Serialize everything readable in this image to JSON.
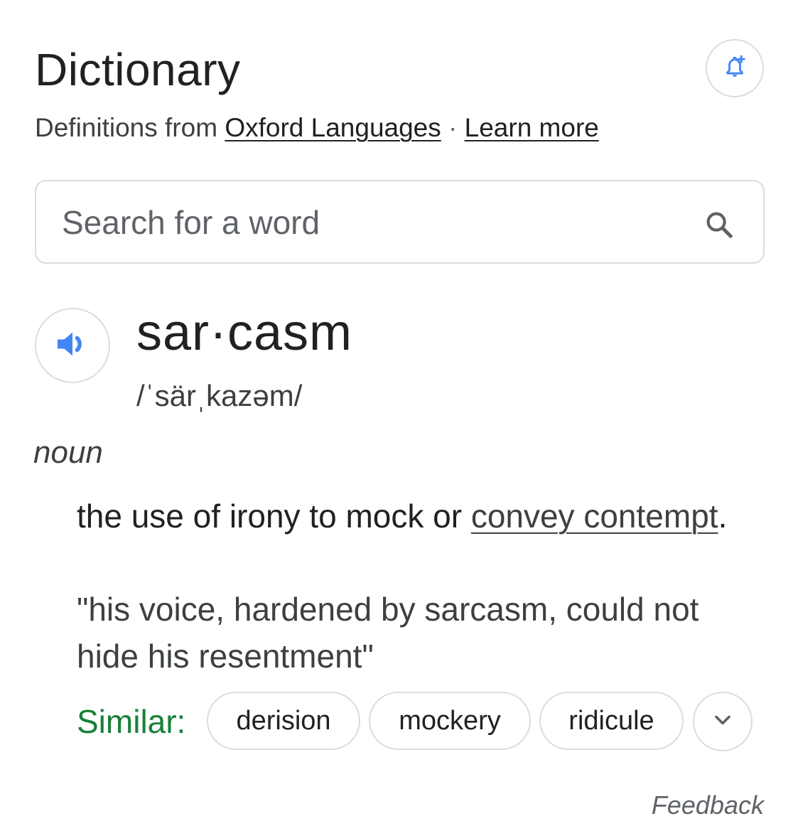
{
  "card": {
    "title": "Dictionary",
    "source_prefix": "Definitions from",
    "source_link": "Oxford Languages",
    "separator": "·",
    "learn_more": "Learn more",
    "alert_icon": "bell-plus-icon"
  },
  "search": {
    "placeholder": "Search for a word",
    "value": "",
    "icon": "search-icon"
  },
  "entry": {
    "audio_icon": "speaker-icon",
    "headword": "sar·casm",
    "phonetic": "/ˈsärˌkazəm/",
    "part_of_speech": "noun",
    "definition_prefix": "the use of irony to mock or ",
    "definition_link": "convey contempt",
    "definition_suffix": ".",
    "example": "\"his voice, hardened by sarcasm, could not hide his resentment\"",
    "similar_label": "Similar:",
    "similar": [
      "derision",
      "mockery",
      "ridicule"
    ],
    "expand_icon": "chevron-down-icon"
  },
  "footer": {
    "feedback": "Feedback"
  },
  "colors": {
    "accent_blue": "#4285f4",
    "similar_green": "#188038",
    "border": "#dadce0"
  }
}
